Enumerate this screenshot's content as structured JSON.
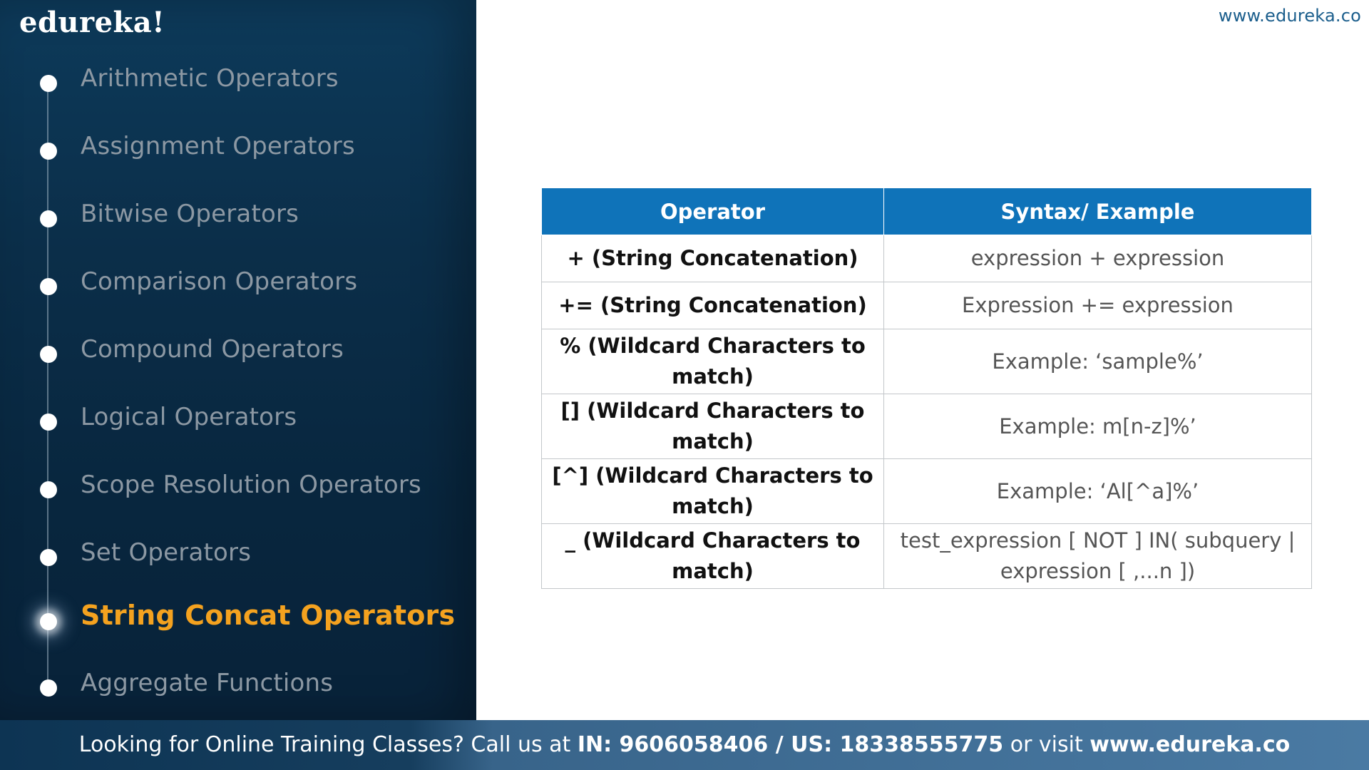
{
  "brand": {
    "logo": "edureka!",
    "site_url": "www.edureka.co"
  },
  "topics": [
    {
      "label": "Arithmetic Operators",
      "active": false
    },
    {
      "label": "Assignment Operators",
      "active": false
    },
    {
      "label": "Bitwise Operators",
      "active": false
    },
    {
      "label": "Comparison Operators",
      "active": false
    },
    {
      "label": "Compound Operators",
      "active": false
    },
    {
      "label": "Logical Operators",
      "active": false
    },
    {
      "label": "Scope Resolution Operators",
      "active": false
    },
    {
      "label": "Set Operators",
      "active": false
    },
    {
      "label": "String Concat Operators",
      "active": true
    },
    {
      "label": "Aggregate Functions",
      "active": false
    }
  ],
  "table": {
    "headers": [
      "Operator",
      "Syntax/ Example"
    ],
    "rows": [
      {
        "operator": "+ (String Concatenation)",
        "example": "expression + expression"
      },
      {
        "operator": "+= (String Concatenation)",
        "example": "Expression += expression"
      },
      {
        "operator": "% (Wildcard Characters to match)",
        "example": "Example: ‘sample%’"
      },
      {
        "operator": "[] (Wildcard Characters to match)",
        "example": "Example:  m[n-z]%’"
      },
      {
        "operator": "[^] (Wildcard Characters to match)",
        "example": "Example:  ‘Al[^a]%’"
      },
      {
        "operator": "_ (Wildcard Characters to match)",
        "example": "test_expression [ NOT ] IN( subquery | expression [ ,...n ])"
      }
    ]
  },
  "footer": {
    "prefix": "Looking for Online Training Classes? Call us at ",
    "phones": "IN: 9606058406 / US: 18338555775",
    "middle": " or visit ",
    "url": "www.edureka.co"
  },
  "colors": {
    "sidebar_bg": "#0b2e49",
    "active_topic": "#f4a21f",
    "table_header": "#0f73b9",
    "inactive_topic": "#8c98a3"
  }
}
